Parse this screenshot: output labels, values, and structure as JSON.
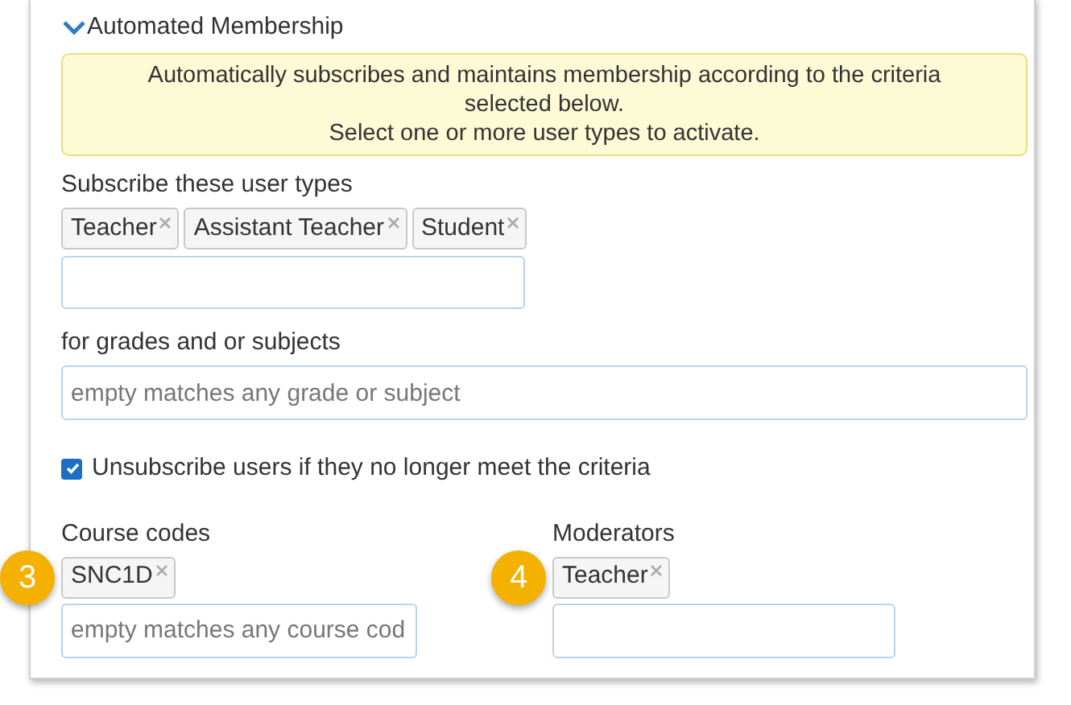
{
  "section": {
    "title": "Automated Membership",
    "expanded": true
  },
  "notice": [
    "Automatically subscribes and maintains membership according to the criteria selected below.",
    "Select one or more user types to activate."
  ],
  "user_types": {
    "label": "Subscribe these user types",
    "tags": [
      "Teacher",
      "Assistant Teacher",
      "Student"
    ]
  },
  "grades": {
    "label": "for grades and or subjects",
    "placeholder": "empty matches any grade or subject"
  },
  "unsubscribe": {
    "label": "Unsubscribe users if they no longer meet the criteria",
    "checked": true
  },
  "course_codes": {
    "label": "Course codes",
    "badge": "3",
    "tags": [
      "SNC1D"
    ],
    "placeholder": "empty matches any course cod"
  },
  "moderators": {
    "label": "Moderators",
    "badge": "4",
    "tags": [
      "Teacher"
    ]
  }
}
